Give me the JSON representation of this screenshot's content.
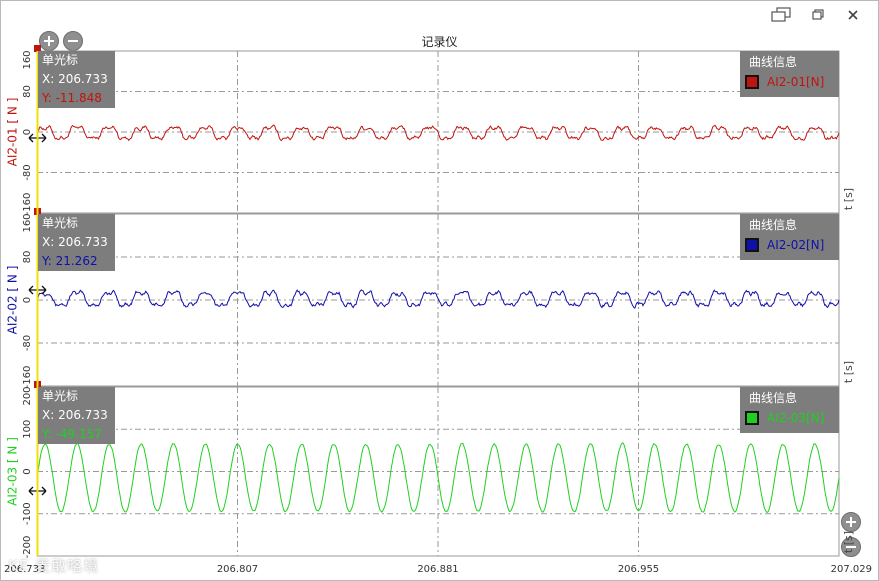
{
  "window": {
    "controls": [
      {
        "name": "restore-windows-icon"
      },
      {
        "name": "restore-icon"
      },
      {
        "name": "close-icon"
      }
    ]
  },
  "toolbar": {
    "zoom_in_icon": "plus-circle-icon",
    "zoom_out_icon": "minus-circle-icon"
  },
  "chart_data": {
    "type": "line",
    "title": "记录仪",
    "x_unit_label": "t [s]",
    "xlim": [
      206.733,
      207.029
    ],
    "x_tick_labels": [
      "206.733",
      "206.807",
      "206.881",
      "206.955",
      "207.029"
    ],
    "grid": true,
    "cursor": {
      "title": "单光标",
      "x_label": "X: 206.733",
      "x": 206.733
    },
    "legend_title": "曲线信息",
    "series": [
      {
        "name": "AI2-01[N]",
        "ylabel": "AI2-01 [ N ]",
        "color": "#c0140f",
        "ylim": [
          -160,
          160
        ],
        "y_ticks": [
          -160,
          -80,
          0,
          80,
          160
        ],
        "cursor_y_label": "Y: -11.848",
        "cursor_y": -11.848,
        "waveform": {
          "cycles": 25,
          "amplitude": 12,
          "offset": -2,
          "noise": 6
        }
      },
      {
        "name": "AI2-02[N]",
        "ylabel": "AI2-02 [ N ]",
        "color": "#1010a8",
        "ylim": [
          -160,
          160
        ],
        "y_ticks": [
          -160,
          -80,
          0,
          80,
          160
        ],
        "cursor_y_label": "Y: 21.262",
        "cursor_y": 21.262,
        "waveform": {
          "cycles": 25,
          "amplitude": 13,
          "offset": 2,
          "noise": 6
        }
      },
      {
        "name": "AI2-03[N]",
        "ylabel": "AI2-03 [ N ]",
        "color": "#20d020",
        "ylim": [
          -200,
          200
        ],
        "y_ticks": [
          -200,
          -100,
          0,
          100,
          200
        ],
        "cursor_y_label": "Y: -49.157",
        "cursor_y": -49.157,
        "waveform": {
          "cycles": 25,
          "amplitude": 80,
          "offset": -15,
          "noise": 4
        }
      }
    ]
  },
  "watermark": "KE 麦敢咯境"
}
